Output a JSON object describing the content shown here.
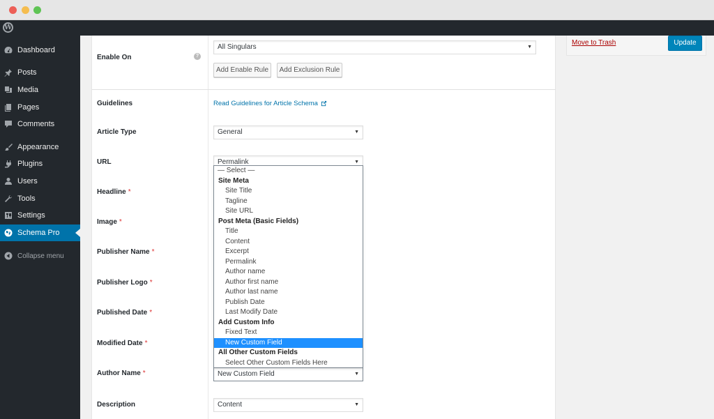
{
  "window": {
    "controls": [
      "close",
      "minimize",
      "maximize"
    ]
  },
  "adminbar": {
    "logo": "W"
  },
  "sidebar": {
    "items": [
      {
        "label": "Dashboard",
        "icon": "dashboard-icon"
      },
      {
        "label": "Posts",
        "icon": "pin-icon"
      },
      {
        "label": "Media",
        "icon": "media-icon"
      },
      {
        "label": "Pages",
        "icon": "pages-icon"
      },
      {
        "label": "Comments",
        "icon": "comments-icon"
      },
      {
        "label": "Appearance",
        "icon": "brush-icon"
      },
      {
        "label": "Plugins",
        "icon": "plugin-icon"
      },
      {
        "label": "Users",
        "icon": "users-icon"
      },
      {
        "label": "Tools",
        "icon": "wrench-icon"
      },
      {
        "label": "Settings",
        "icon": "settings-icon"
      },
      {
        "label": "Schema Pro",
        "icon": "globe-icon",
        "active": true
      },
      {
        "label": "Collapse menu",
        "icon": "collapse-icon"
      }
    ]
  },
  "form": {
    "enable_on": {
      "label": "Enable On",
      "value": "All Singulars",
      "help": "?",
      "add_enable_rule": "Add Enable Rule",
      "add_exclusion_rule": "Add Exclusion Rule"
    },
    "guidelines": {
      "label": "Guidelines",
      "link": "Read Guidelines for Article Schema"
    },
    "article_type": {
      "label": "Article Type",
      "value": "General"
    },
    "url": {
      "label": "URL",
      "value": "Permalink"
    },
    "headline": {
      "label": "Headline",
      "required": "*"
    },
    "image": {
      "label": "Image",
      "required": "*"
    },
    "publisher_name": {
      "label": "Publisher Name",
      "required": "*"
    },
    "publisher_logo": {
      "label": "Publisher Logo",
      "required": "*"
    },
    "published_date": {
      "label": "Published Date",
      "required": "*"
    },
    "modified_date": {
      "label": "Modified Date",
      "required": "*"
    },
    "author_name": {
      "label": "Author Name",
      "required": "*",
      "value": "New Custom Field"
    },
    "description": {
      "label": "Description",
      "value": "Content"
    }
  },
  "dropdown": {
    "options": [
      {
        "label": "— Select —",
        "type": "first"
      },
      {
        "label": "Site Meta",
        "type": "group"
      },
      {
        "label": "Site Title",
        "type": "option"
      },
      {
        "label": "Tagline",
        "type": "option"
      },
      {
        "label": "Site URL",
        "type": "option"
      },
      {
        "label": "Post Meta (Basic Fields)",
        "type": "group"
      },
      {
        "label": "Title",
        "type": "option"
      },
      {
        "label": "Content",
        "type": "option"
      },
      {
        "label": "Excerpt",
        "type": "option"
      },
      {
        "label": "Permalink",
        "type": "option"
      },
      {
        "label": "Author name",
        "type": "option"
      },
      {
        "label": "Author first name",
        "type": "option"
      },
      {
        "label": "Author last name",
        "type": "option"
      },
      {
        "label": "Publish Date",
        "type": "option"
      },
      {
        "label": "Last Modify Date",
        "type": "option"
      },
      {
        "label": "Add Custom Info",
        "type": "group"
      },
      {
        "label": "Fixed Text",
        "type": "option"
      },
      {
        "label": "New Custom Field",
        "type": "option",
        "selected": true
      },
      {
        "label": "All Other Custom Fields",
        "type": "group"
      },
      {
        "label": "Select Other Custom Fields Here",
        "type": "option"
      }
    ]
  },
  "publish": {
    "move_to_trash": "Move to Trash",
    "update": "Update"
  },
  "colors": {
    "accent": "#0073aa",
    "update_button": "#0085ba",
    "selected_option": "#1e90ff",
    "trash": "#aa0000",
    "required": "#dc3232"
  }
}
